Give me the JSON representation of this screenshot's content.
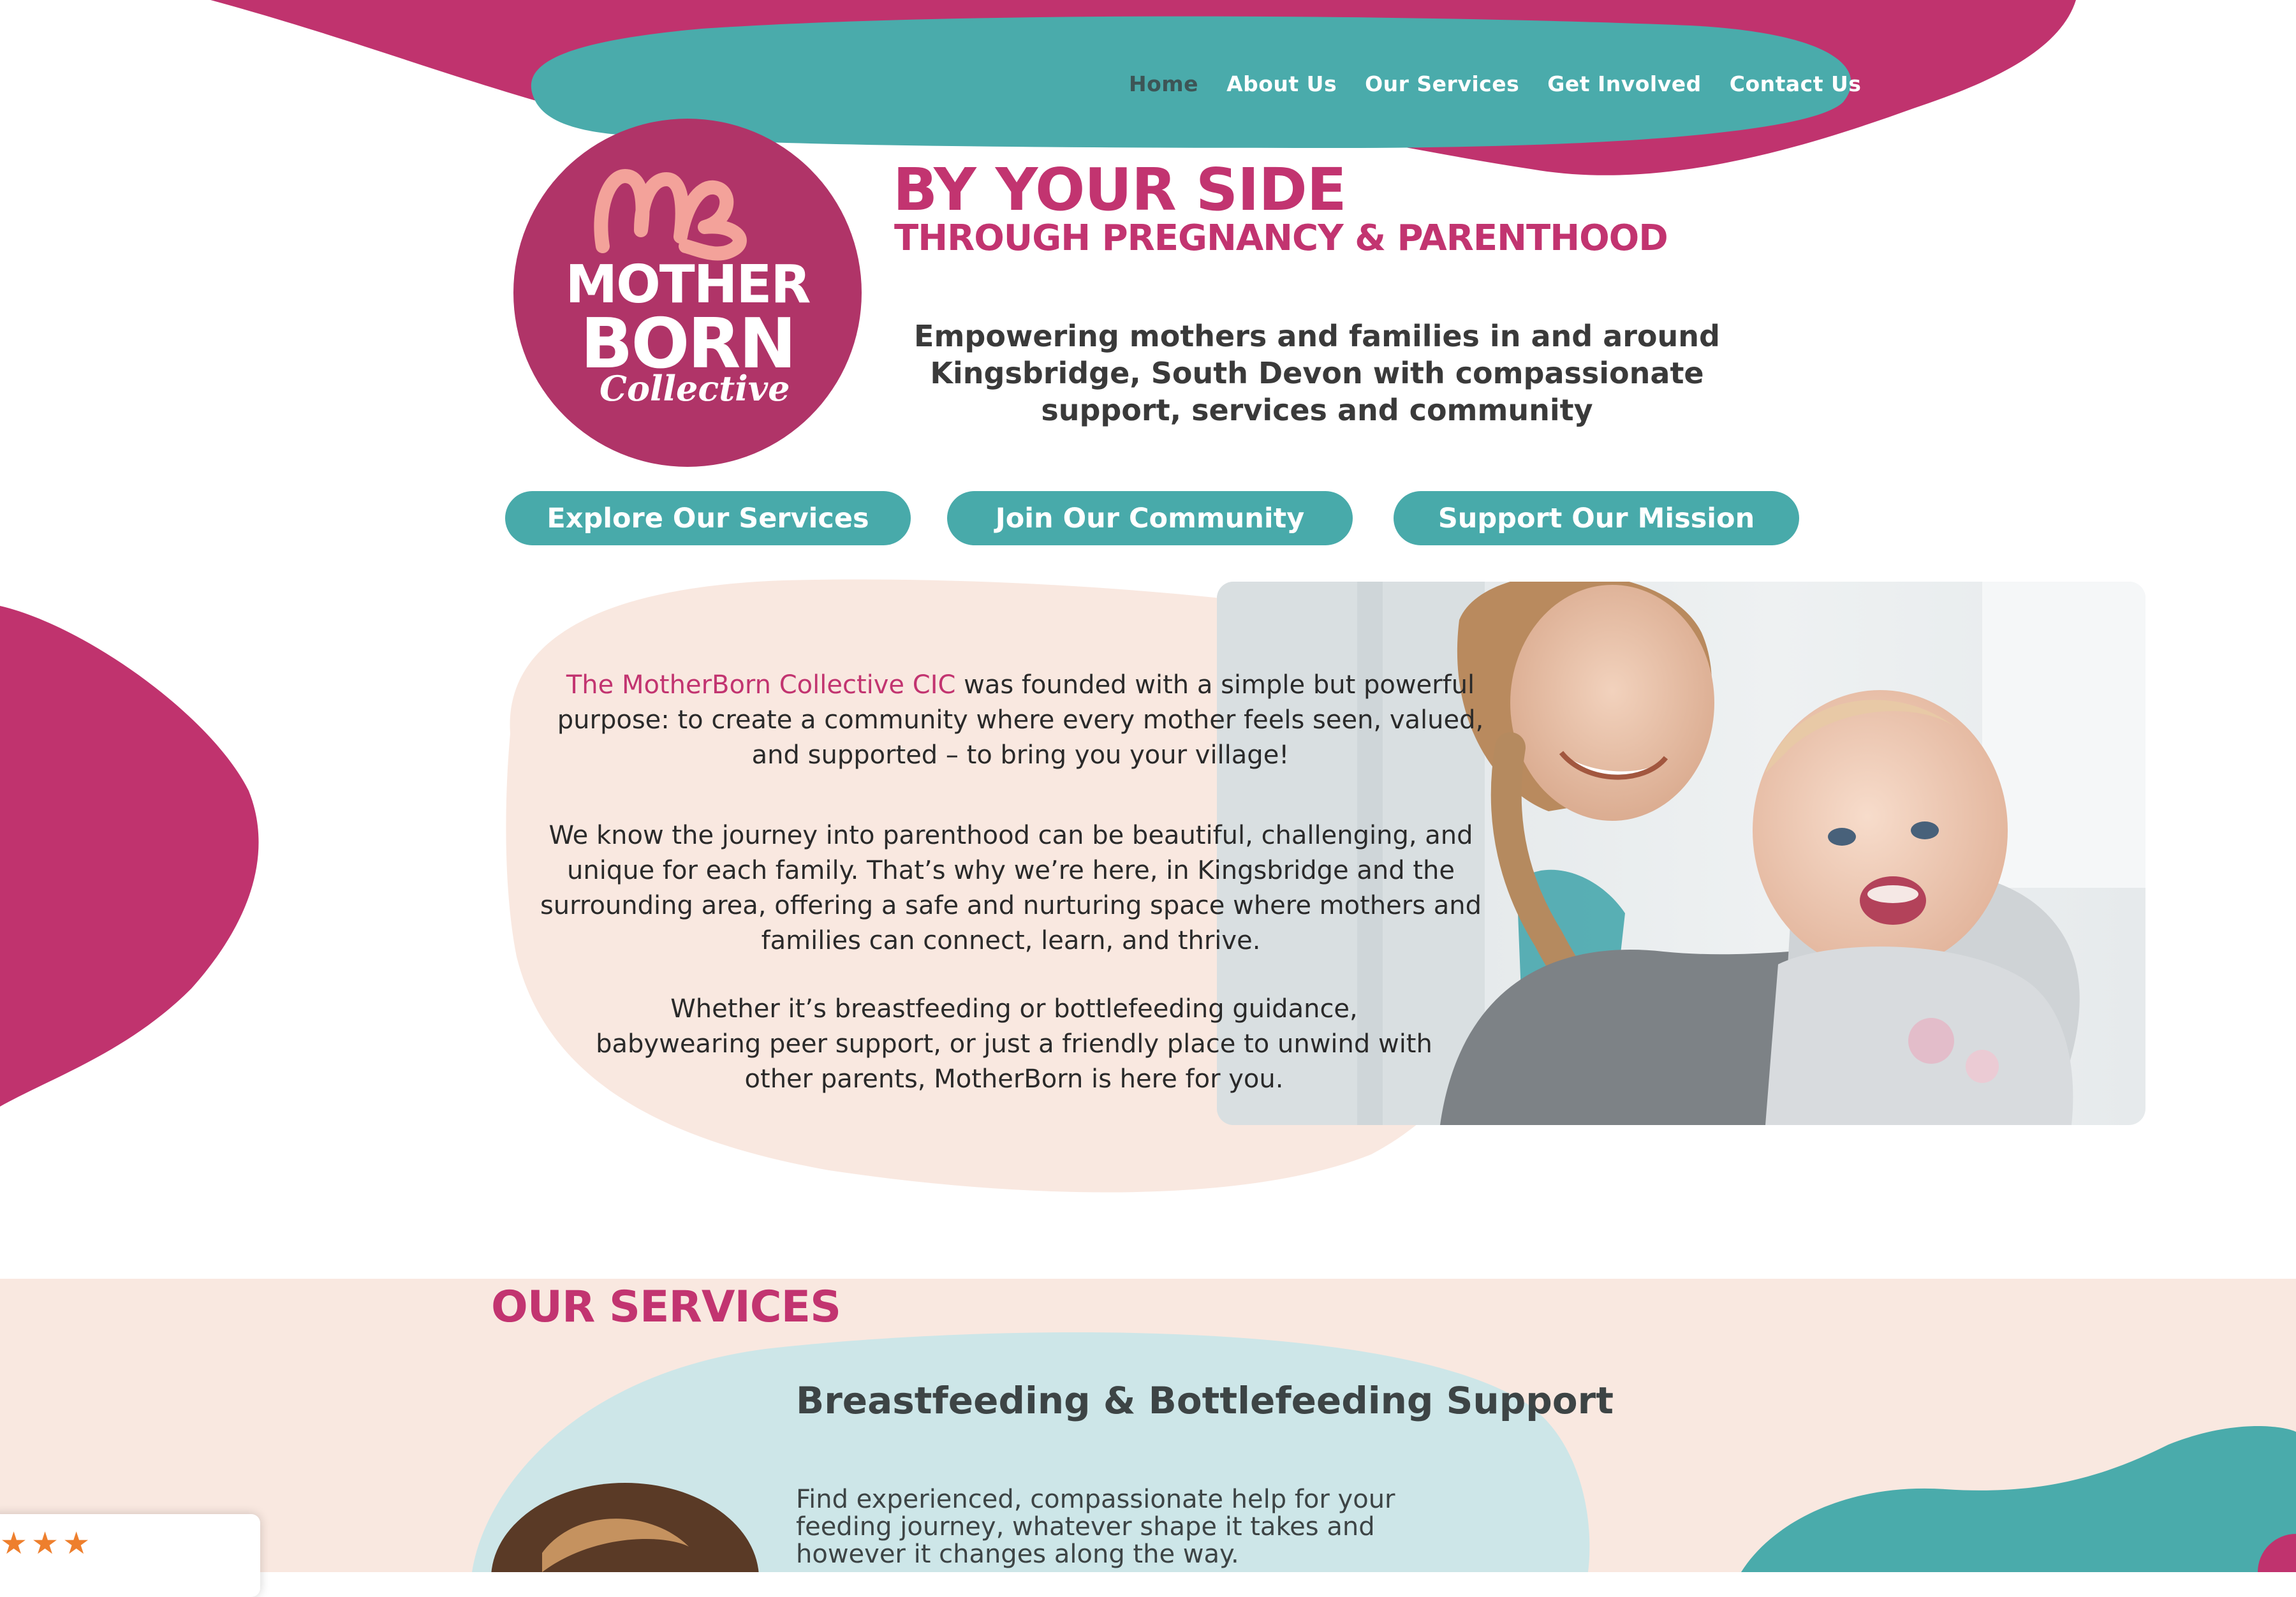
{
  "nav": {
    "items": [
      {
        "label": "Home",
        "active": true
      },
      {
        "label": "About Us"
      },
      {
        "label": "Our Services"
      },
      {
        "label": "Get Involved"
      },
      {
        "label": "Contact Us"
      }
    ]
  },
  "logo": {
    "line1": "MOTHER",
    "line2": "BORN",
    "line3": "Collective"
  },
  "hero": {
    "title": "BY YOUR SIDE",
    "subtitle": "THROUGH PREGNANCY & PARENTHOOD",
    "tagline": "Empowering mothers and families in and around Kingsbridge, South Devon with compassionate support, services and community"
  },
  "cta": {
    "explore": "Explore Our Services",
    "join": "Join Our Community",
    "support": "Support Our Mission"
  },
  "intro": {
    "highlight": "The MotherBorn Collective CIC",
    "p1_rest": " was founded with a simple but powerful purpose: to create a community where every mother feels seen, valued, and supported – to bring you your village!",
    "p2": "We know the journey into parenthood can be beautiful, challenging, and unique for each family. That’s why we’re here, in Kingsbridge and the surrounding area, offering a safe and nurturing space where mothers and families can connect, learn, and thrive.",
    "p3": "Whether it’s breastfeeding or bottlefeeding guidance, babywearing peer support, or just a friendly place to unwind with other parents, MotherBorn is here for you."
  },
  "services": {
    "heading": "OUR SERVICES",
    "card_title": "Breastfeeding & Bottlefeeding Support",
    "card_desc": "Find experienced, compassionate help for your feeding journey, whatever shape it takes and however it changes along the way."
  },
  "review_widget": {
    "stars": "★★★"
  },
  "colors": {
    "brand_pink": "#c23470",
    "logo_pink": "#b03468",
    "teal": "#48aaaa",
    "peach": "#f9e8e0",
    "light_blue": "#cde6e8"
  }
}
